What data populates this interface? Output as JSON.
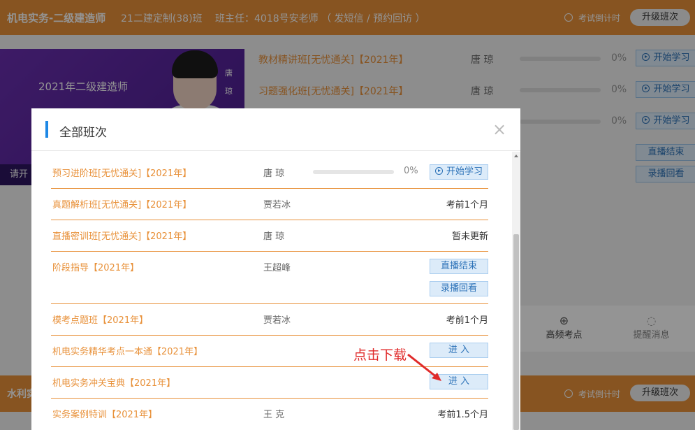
{
  "header": {
    "course": "机电实务-二级建造师",
    "class_name": "21二建定制(38)班",
    "teacher_info": "班主任：4018号安老师 （ 发短信 / 预约回访 ）",
    "countdown": "考试倒计时",
    "upgrade": "升级班次"
  },
  "banner": {
    "title": "2021年二级建造师",
    "teacher_name_1": "唐",
    "teacher_name_2": "琼",
    "left_text": "请开"
  },
  "bg_list": [
    {
      "name": "教材精讲班[无忧通关]【2021年】",
      "teacher": "唐  琼",
      "pct": "0%",
      "button": "开始学习"
    },
    {
      "name": "习题强化班[无忧通关]【2021年】",
      "teacher": "唐  琼",
      "pct": "0%",
      "button": "开始学习"
    },
    {
      "pct": "0%",
      "button": "开始学习"
    }
  ],
  "bg_buttons": {
    "live_end": "直播结束",
    "replay": "录播回看"
  },
  "bg_features": {
    "high_freq": "高频考点",
    "reminder": "提醒消息"
  },
  "bg_header2": {
    "label": "水利实",
    "countdown": "考试倒计时",
    "upgrade": "升级班次"
  },
  "modal": {
    "title": "全部班次",
    "close": "×",
    "rows": [
      {
        "name": "预习进阶班[无忧通关]【2021年】",
        "teacher": "唐  琼",
        "pct": "0%",
        "button": "开始学习"
      },
      {
        "name": "真题解析班[无忧通关]【2021年】",
        "teacher": "贾若冰",
        "status": "考前1个月"
      },
      {
        "name": "直播密训班[无忧通关]【2021年】",
        "teacher": "唐  琼",
        "status": "暂未更新"
      },
      {
        "name": "阶段指导【2021年】",
        "teacher": "王超峰",
        "button1": "直播结束",
        "button2": "录播回看"
      },
      {
        "name": "模考点题班【2021年】",
        "teacher": "贾若冰",
        "status": "考前1个月"
      },
      {
        "name": "机电实务精华考点一本通【2021年】",
        "button": "进  入"
      },
      {
        "name": "机电实务冲关宝典【2021年】",
        "button": "进  入"
      },
      {
        "name": "实务案例特训【2021年】",
        "teacher": "王  克",
        "status": "考前1.5个月"
      }
    ]
  },
  "annotation": "点击下载",
  "colors": {
    "orange": "#e8913a",
    "blue": "#1e88e5",
    "red": "#e02a2a"
  }
}
